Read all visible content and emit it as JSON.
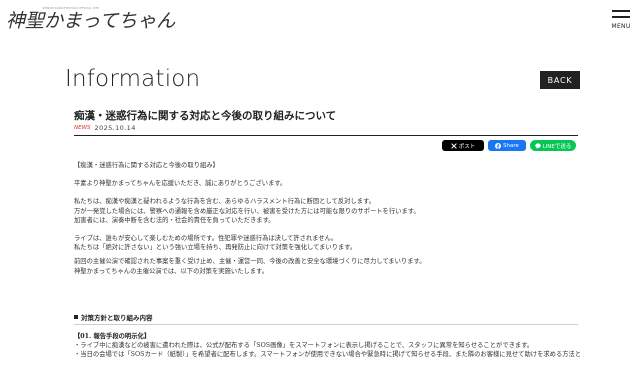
{
  "logo": {
    "text": "神聖かまってちゃん",
    "sub": "SHINSEI KAMATTECHAN OFFICIAL SITE"
  },
  "menu": {
    "label": "MENU"
  },
  "page": {
    "title": "Information",
    "back_label": "BACK"
  },
  "article": {
    "title": "痴漢・迷惑行為に関する対応と今後の取り組みについて",
    "badge": "NEWS",
    "date": "2025.10.14"
  },
  "share": {
    "x_label": "ポスト",
    "facebook_label": "Share",
    "line_label": "LINEで送る"
  },
  "body": {
    "heading": "【痴漢・迷惑行為に関する対応と今後の取り組み】",
    "p1": "平素より神聖かまってちゃんを応援いただき、誠にありがとうございます。",
    "p2_1": "私たちは、痴漢や痴漢と疑われるような行為を含む、あらゆるハラスメント行為に断固として反対します。",
    "p2_2": "万が一発覚した場合には、警察への通報を含め厳正な対応を行い、被害を受けた方には可能な限りのサポートを行います。",
    "p2_3": "加害者には、演奏中断を含む法的・社会的責任を負っていただきます。",
    "p3_1": "ライブは、誰もが安心して楽しむための場所です。性犯罪や迷惑行為は決して許されません。",
    "p3_2": "私たちは「絶対に許さない」という強い立場を持ち、再発防止に向けて対策を強化してまいります。",
    "p4_1": "前回の主催公演で確認された事案を重く受け止め、主催・運営一同、今後の改善と安全な環境づくりに尽力してまいります。",
    "p4_2": "神聖かまってちゃんの主催公演では、以下の対策を実施いたします。"
  },
  "section": {
    "title": "対策方針と取り組み内容",
    "sub1": "【01. 報告手段の明示化】",
    "b1_1": "・ライブ中に痴漢などの被害に遭われた際は、公式が配布する「SOS画像」をスマートフォンに表示し掲げることで、スタッフに異常を知らせることができます。",
    "b1_2": "・当日の会場では「SOSカード（紙製）」を希望者に配布します。スマートフォンが使用できない場合や緊急時に掲げて知らせる手段、また隣のお客様に見せて助けを求める方法としてご利用ください。"
  }
}
